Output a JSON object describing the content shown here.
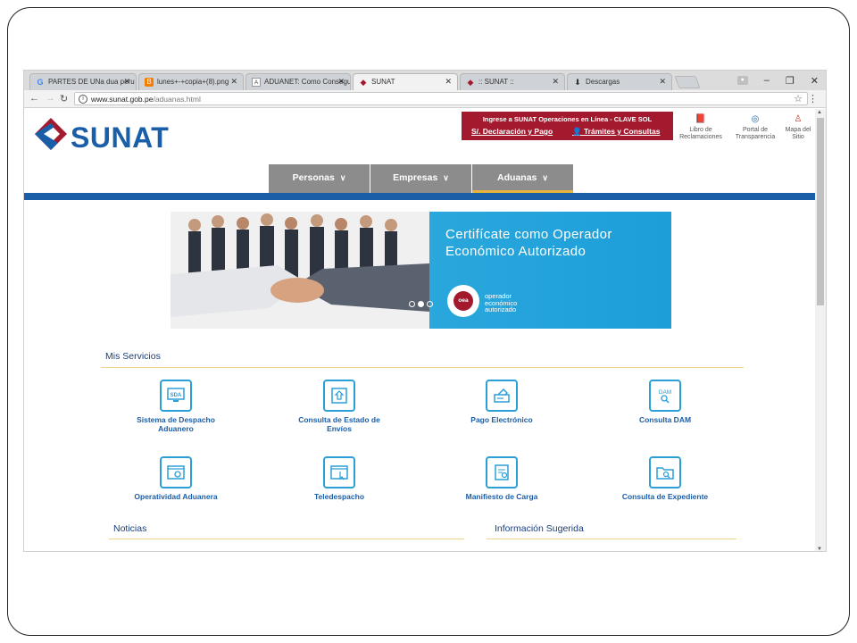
{
  "browser": {
    "tabs": [
      {
        "icon": "google-icon",
        "icon_glyph": "G",
        "label": "PARTES DE UNa dua peru"
      },
      {
        "icon": "blogger-icon",
        "icon_glyph": "B",
        "label": "lunes+-+copia+(8).png"
      },
      {
        "icon": "page-icon",
        "icon_glyph": "A",
        "label": "ADUANET: Como Consegu"
      },
      {
        "icon": "sunat-favicon-icon",
        "icon_glyph": "◆",
        "label": "SUNAT"
      },
      {
        "icon": "sunat-favicon-icon",
        "icon_glyph": "◆",
        "label": ":: SUNAT ::"
      },
      {
        "icon": "download-icon",
        "icon_glyph": "⬇",
        "label": "Descargas"
      }
    ],
    "active_tab_index": 3,
    "url_host": "www.sunat.gob.pe",
    "url_path": "/aduanas.html"
  },
  "header": {
    "logo_text": "SUNAT",
    "login": {
      "title": "Ingrese a SUNAT Operaciones en Línea - CLAVE SOL",
      "link_payment": "S/.  Declaración y Pago",
      "link_procedures": "Trámites y Consultas"
    },
    "links": [
      {
        "icon": "complaint-book-icon",
        "label": "Libro de Reclamaciones"
      },
      {
        "icon": "transparency-portal-icon",
        "label": "Portal de Transparencia"
      },
      {
        "icon": "sitemap-icon",
        "label": "Mapa del Sitio"
      }
    ]
  },
  "menu": {
    "items": [
      "Personas",
      "Empresas",
      "Aduanas"
    ],
    "active": "Aduanas"
  },
  "banner": {
    "title": "Certifícate como Operador Económico Autorizado",
    "logo_abbr": "oea",
    "logo_text": [
      "operador",
      "económico",
      "autorizado"
    ],
    "dots": 3,
    "active_dot": 1
  },
  "services": {
    "title": "Mis Servicios",
    "items": [
      {
        "icon": "sda-monitor-icon",
        "label": "Sistema de Despacho Aduanero"
      },
      {
        "icon": "shipment-status-icon",
        "label": "Consulta de Estado de Envíos"
      },
      {
        "icon": "electronic-payment-icon",
        "label": "Pago Electrónico"
      },
      {
        "icon": "dam-search-icon",
        "label": "Consulta DAM"
      },
      {
        "icon": "operations-settings-icon",
        "label": "Operatividad Aduanera"
      },
      {
        "icon": "teledespacho-icon",
        "label": "Teledespacho"
      },
      {
        "icon": "cargo-manifest-icon",
        "label": "Manifiesto de Carga"
      },
      {
        "icon": "file-search-icon",
        "label": "Consulta de Expediente"
      }
    ]
  },
  "news": {
    "title": "Noticias"
  },
  "suggested": {
    "title": "Información Sugerida"
  },
  "colors": {
    "brand_blue": "#1a5ea8",
    "brand_red": "#a3192d",
    "accent_gold": "#e8b43a",
    "banner_blue": "#1d9ed9"
  }
}
